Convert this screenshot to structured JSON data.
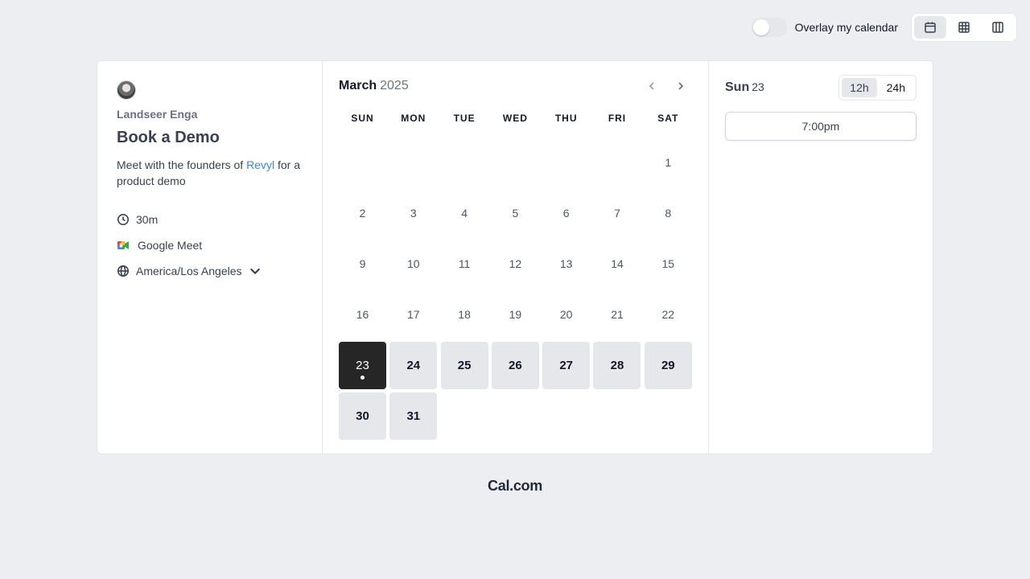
{
  "topbar": {
    "overlay_label": "Overlay my calendar",
    "overlay_on": false,
    "views": [
      {
        "name": "month-view",
        "icon": "calendar-icon",
        "active": true
      },
      {
        "name": "week-view",
        "icon": "grid-icon",
        "active": false
      },
      {
        "name": "column-view",
        "icon": "columns-icon",
        "active": false
      }
    ]
  },
  "event": {
    "host": "Landseer Enga",
    "title": "Book a Demo",
    "description_prefix": "Meet with the founders of ",
    "description_link": "Revyl",
    "description_suffix": " for a product demo",
    "duration": "30m",
    "location": "Google Meet",
    "timezone": "America/Los Angeles"
  },
  "calendar": {
    "month": "March",
    "year": "2025",
    "weekdays": [
      "SUN",
      "MON",
      "TUE",
      "WED",
      "THU",
      "FRI",
      "SAT"
    ],
    "days": [
      "",
      "",
      "",
      "",
      "",
      "",
      "1",
      "2",
      "3",
      "4",
      "5",
      "6",
      "7",
      "8",
      "9",
      "10",
      "11",
      "12",
      "13",
      "14",
      "15",
      "16",
      "17",
      "18",
      "19",
      "20",
      "21",
      "22",
      "23",
      "24",
      "25",
      "26",
      "27",
      "28",
      "29",
      "30",
      "31"
    ],
    "available_days": [
      "23",
      "24",
      "25",
      "26",
      "27",
      "28",
      "29",
      "30",
      "31"
    ],
    "selected_day": "23"
  },
  "slots": {
    "day_name": "Sun",
    "day_number": "23",
    "format_12h": "12h",
    "format_24h": "24h",
    "active_format": "12h",
    "times": [
      "7:00pm"
    ]
  },
  "footer": {
    "brand": "Cal.com"
  },
  "colors": {
    "background": "#edeef2",
    "selected_day": "#262626",
    "available_day": "#e5e7eb",
    "link": "#3b82f6"
  }
}
